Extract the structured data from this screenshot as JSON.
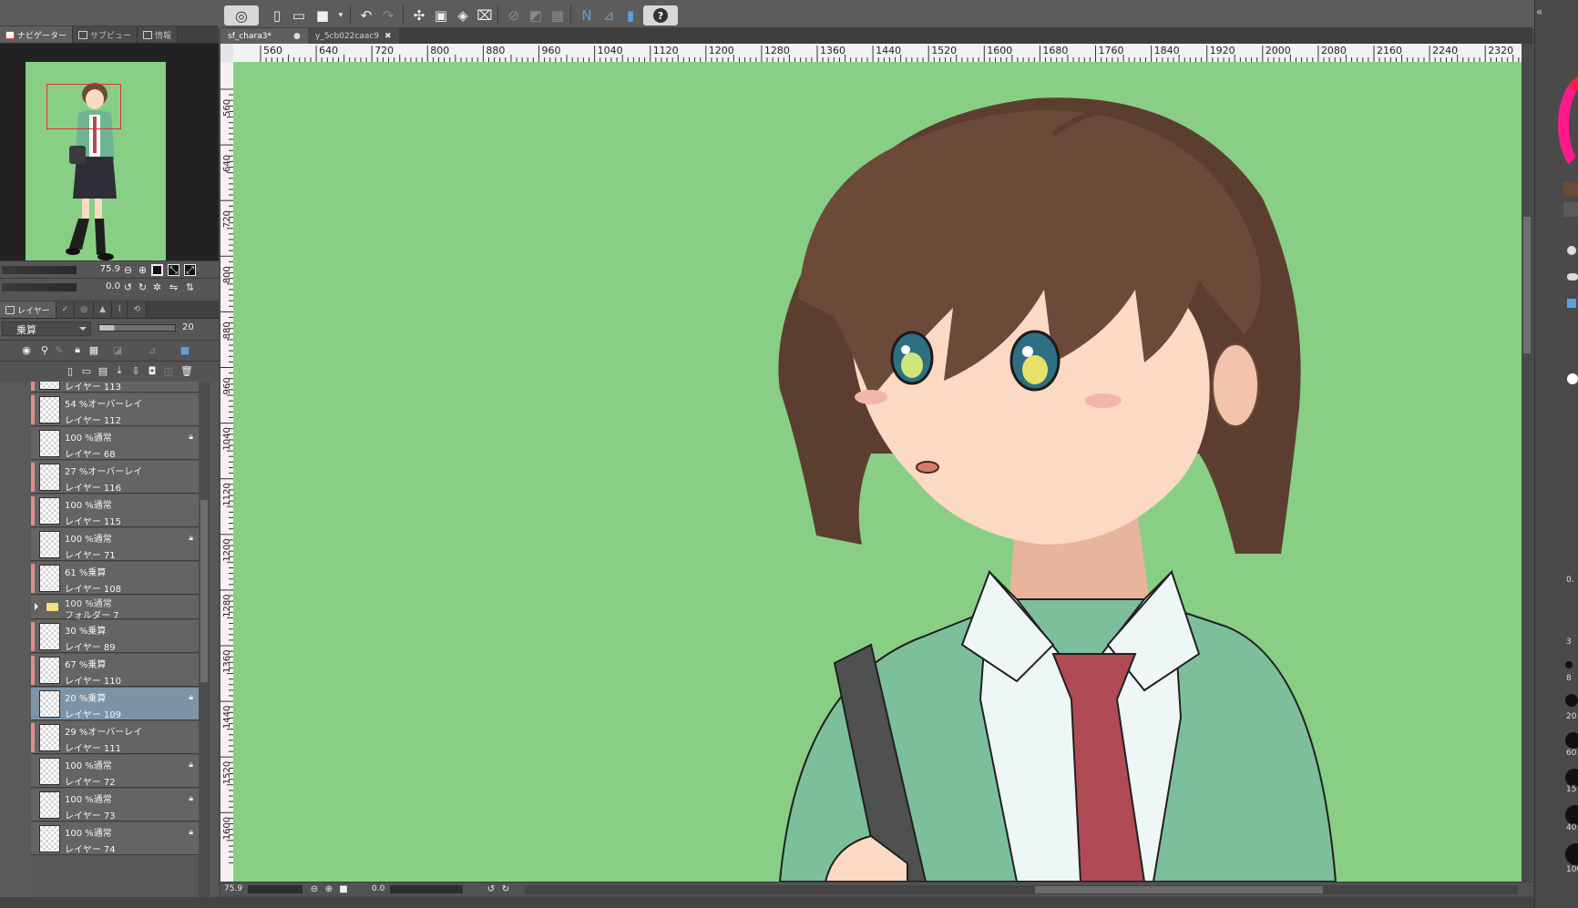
{
  "toolbar": {
    "logo_icon": "clip-studio-logo",
    "help_label": "?",
    "buttons": [
      "new-icon",
      "open-icon",
      "save-icon",
      "undo-icon",
      "redo-icon",
      "transform-icon",
      "fit-icon",
      "fill-icon",
      "crop-icon",
      "ruler-icon",
      "snap-icon",
      "grid-icon",
      "help-icon"
    ]
  },
  "left_panel": {
    "tabs": [
      {
        "label": "ナビゲーター",
        "active": true
      },
      {
        "label": "サブビュー",
        "active": false
      },
      {
        "label": "情報",
        "active": false
      }
    ],
    "navigator": {
      "zoom_value": "75.9",
      "angle_value": "0.0"
    },
    "layer_tabs": [
      {
        "label": "レイヤー",
        "active": true
      }
    ],
    "blend_mode": "乗算",
    "opacity_value": "20",
    "layers": [
      {
        "blend": "",
        "name": "レイヤー 113",
        "partial": true
      },
      {
        "blend": "54 %オーバーレイ",
        "name": "レイヤー 112",
        "lock": false
      },
      {
        "blend": "100 %通常",
        "name": "レイヤー 68",
        "lock": true
      },
      {
        "blend": "27 %オーバーレイ",
        "name": "レイヤー 116",
        "lock": false
      },
      {
        "blend": "100 %通常",
        "name": "レイヤー 115",
        "lock": false
      },
      {
        "blend": "100 %通常",
        "name": "レイヤー 71",
        "lock": true
      },
      {
        "blend": "61 %乗算",
        "name": "レイヤー 108",
        "lock": false
      },
      {
        "blend": "100 %通常",
        "name": "フォルダー 7",
        "folder": true
      },
      {
        "blend": "30 %乗算",
        "name": "レイヤー 89",
        "lock": false
      },
      {
        "blend": "67 %乗算",
        "name": "レイヤー 110",
        "lock": false
      },
      {
        "blend": "20 %乗算",
        "name": "レイヤー 109",
        "lock": true,
        "selected": true
      },
      {
        "blend": "29 %オーバーレイ",
        "name": "レイヤー 111",
        "lock": false
      },
      {
        "blend": "100 %通常",
        "name": "レイヤー 72",
        "lock": true
      },
      {
        "blend": "100 %通常",
        "name": "レイヤー 73",
        "lock": true
      },
      {
        "blend": "100 %通常",
        "name": "レイヤー 74",
        "lock": true
      }
    ]
  },
  "documents": [
    {
      "title": "sf_chara3*",
      "active": true,
      "close": "●"
    },
    {
      "title": "y_5cb022caac9",
      "active": false,
      "close": "✖"
    }
  ],
  "rulers": {
    "top": [
      "560",
      "640",
      "720",
      "800",
      "880",
      "960",
      "1040",
      "1120",
      "1200",
      "1280",
      "1360",
      "1440",
      "1520",
      "1600",
      "1680",
      "1760",
      "1840",
      "1920",
      "2000",
      "2080",
      "2160",
      "2240",
      "2320"
    ],
    "left": [
      "560",
      "640",
      "720",
      "800",
      "880",
      "960",
      "1040",
      "1120",
      "1200",
      "1280",
      "1360",
      "1440",
      "1520",
      "1600"
    ]
  },
  "status": {
    "zoom": "75.9",
    "angle": "0.0"
  },
  "right_dock": {
    "brush_sizes": [
      "0.",
      "3",
      "8",
      "20",
      "60",
      "15",
      "40",
      "100"
    ]
  },
  "colors": {
    "canvas_bg": "#88cf85",
    "hair": "#6b4a3a",
    "skin": "#fbd9c3",
    "cardigan": "#7dbf9b",
    "tie": "#b04a55",
    "selected_layer": "#7d94a6",
    "layer_color_bar": "#e08c88"
  }
}
